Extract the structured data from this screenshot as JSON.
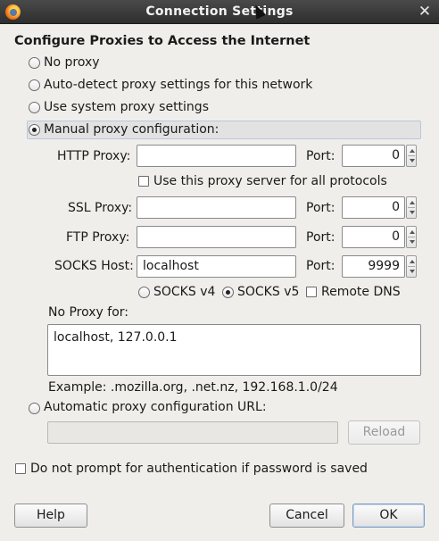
{
  "window": {
    "title": "Connection Settings",
    "close_glyph": "✕"
  },
  "heading": "Configure Proxies to Access the Internet",
  "proxy_options": [
    {
      "label": "No proxy",
      "selected": false
    },
    {
      "label": "Auto-detect proxy settings for this network",
      "selected": false
    },
    {
      "label": "Use system proxy settings",
      "selected": false
    },
    {
      "label": "Manual proxy configuration:",
      "selected": true
    }
  ],
  "manual": {
    "http": {
      "label": "HTTP Proxy:",
      "value": "",
      "port_label": "Port:",
      "port": "0"
    },
    "share_all": {
      "label": "Use this proxy server for all protocols",
      "checked": false
    },
    "ssl": {
      "label": "SSL Proxy:",
      "value": "",
      "port_label": "Port:",
      "port": "0"
    },
    "ftp": {
      "label": "FTP Proxy:",
      "value": "",
      "port_label": "Port:",
      "port": "0"
    },
    "socks": {
      "label": "SOCKS Host:",
      "value": "localhost",
      "port_label": "Port:",
      "port": "9999"
    },
    "socks_v4": {
      "label": "SOCKS v4",
      "selected": false
    },
    "socks_v5": {
      "label": "SOCKS v5",
      "selected": true
    },
    "remote_dns": {
      "label": "Remote DNS",
      "checked": false
    },
    "no_proxy_label": "No Proxy for:",
    "no_proxy_value": "localhost, 127.0.0.1",
    "example": "Example: .mozilla.org, .net.nz, 192.168.1.0/24"
  },
  "auto_config": {
    "label": "Automatic proxy configuration URL:",
    "selected": false,
    "url": "",
    "reload_label": "Reload"
  },
  "no_prompt": {
    "label": "Do not prompt for authentication if password is saved",
    "checked": false
  },
  "buttons": {
    "help": "Help",
    "cancel": "Cancel",
    "ok": "OK"
  }
}
